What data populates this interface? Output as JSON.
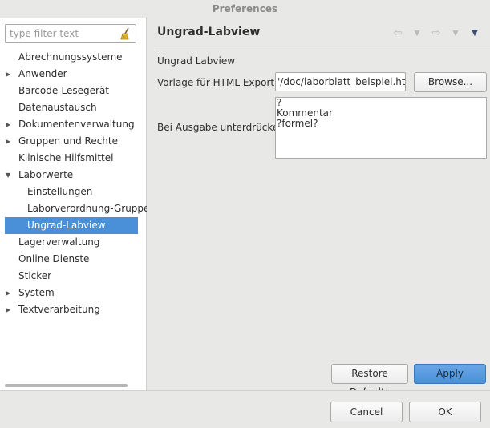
{
  "window": {
    "title": "Preferences"
  },
  "filter": {
    "placeholder": "type filter text"
  },
  "tree": {
    "items": [
      {
        "label": "Abrechnungssysteme",
        "level": 0,
        "expandable": false
      },
      {
        "label": "Anwender",
        "level": 0,
        "expandable": true
      },
      {
        "label": "Barcode-Lesegerät",
        "level": 0,
        "expandable": false
      },
      {
        "label": "Datenaustausch",
        "level": 0,
        "expandable": false
      },
      {
        "label": "Dokumentenverwaltung",
        "level": 0,
        "expandable": true
      },
      {
        "label": "Gruppen und Rechte",
        "level": 0,
        "expandable": true
      },
      {
        "label": "Klinische Hilfsmittel",
        "level": 0,
        "expandable": false
      },
      {
        "label": "Laborwerte",
        "level": 0,
        "expandable": true,
        "expanded": true
      },
      {
        "label": "Einstellungen",
        "level": 1,
        "expandable": false
      },
      {
        "label": "Laborverordnung-Gruppe",
        "level": 1,
        "expandable": false
      },
      {
        "label": "Ungrad-Labview",
        "level": 1,
        "expandable": false,
        "selected": true
      },
      {
        "label": "Lagerverwaltung",
        "level": 0,
        "expandable": false
      },
      {
        "label": "Online Dienste",
        "level": 0,
        "expandable": false
      },
      {
        "label": "Sticker",
        "level": 0,
        "expandable": false
      },
      {
        "label": "System",
        "level": 0,
        "expandable": true
      },
      {
        "label": "Textverarbeitung",
        "level": 0,
        "expandable": true
      }
    ]
  },
  "page": {
    "title": "Ungrad-Labview",
    "section_label": "Ungrad Labview",
    "template_label": "Vorlage für HTML Export",
    "template_value": "'/doc/laborblatt_beispiel.html",
    "browse_label": "Browse...",
    "suppress_label": "Bei Ausgabe unterdrücken",
    "suppress_lines": [
      "?",
      "Kommentar",
      "?formel?"
    ]
  },
  "nav": {
    "back_icon": "arrow-left-icon",
    "back_menu_icon": "chevron-down-icon",
    "forward_icon": "arrow-right-icon",
    "forward_menu_icon": "chevron-down-icon",
    "view_menu_icon": "view-menu-icon"
  },
  "actions": {
    "restore_label": "Restore Defaults",
    "apply_label": "Apply",
    "cancel_label": "Cancel",
    "ok_label": "OK"
  },
  "colors": {
    "selection": "#4a90d9",
    "accent": "#4a90d9"
  }
}
